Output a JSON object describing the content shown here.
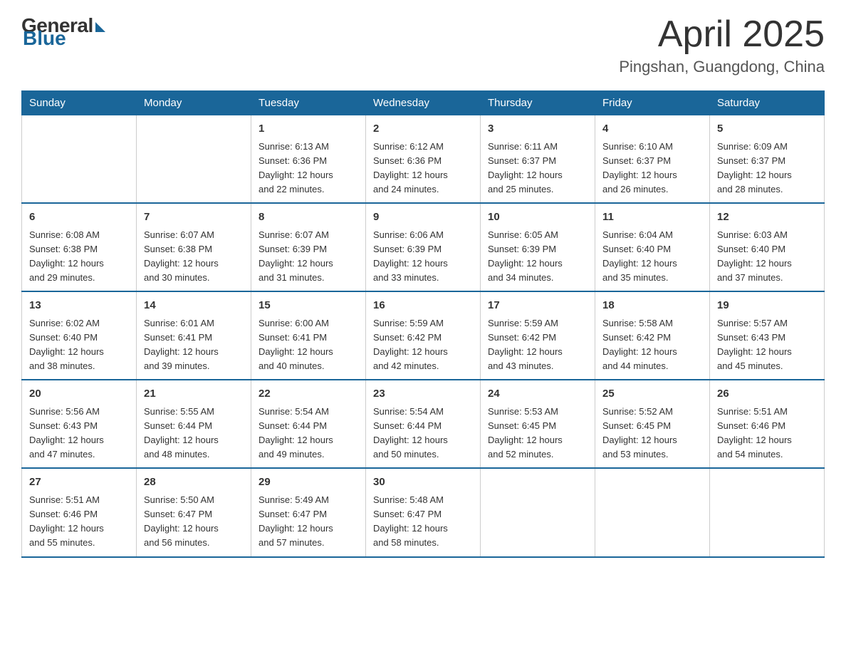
{
  "logo": {
    "general": "General",
    "blue": "Blue"
  },
  "header": {
    "month": "April 2025",
    "location": "Pingshan, Guangdong, China"
  },
  "weekdays": [
    "Sunday",
    "Monday",
    "Tuesday",
    "Wednesday",
    "Thursday",
    "Friday",
    "Saturday"
  ],
  "weeks": [
    [
      {
        "day": "",
        "info": ""
      },
      {
        "day": "",
        "info": ""
      },
      {
        "day": "1",
        "info": "Sunrise: 6:13 AM\nSunset: 6:36 PM\nDaylight: 12 hours\nand 22 minutes."
      },
      {
        "day": "2",
        "info": "Sunrise: 6:12 AM\nSunset: 6:36 PM\nDaylight: 12 hours\nand 24 minutes."
      },
      {
        "day": "3",
        "info": "Sunrise: 6:11 AM\nSunset: 6:37 PM\nDaylight: 12 hours\nand 25 minutes."
      },
      {
        "day": "4",
        "info": "Sunrise: 6:10 AM\nSunset: 6:37 PM\nDaylight: 12 hours\nand 26 minutes."
      },
      {
        "day": "5",
        "info": "Sunrise: 6:09 AM\nSunset: 6:37 PM\nDaylight: 12 hours\nand 28 minutes."
      }
    ],
    [
      {
        "day": "6",
        "info": "Sunrise: 6:08 AM\nSunset: 6:38 PM\nDaylight: 12 hours\nand 29 minutes."
      },
      {
        "day": "7",
        "info": "Sunrise: 6:07 AM\nSunset: 6:38 PM\nDaylight: 12 hours\nand 30 minutes."
      },
      {
        "day": "8",
        "info": "Sunrise: 6:07 AM\nSunset: 6:39 PM\nDaylight: 12 hours\nand 31 minutes."
      },
      {
        "day": "9",
        "info": "Sunrise: 6:06 AM\nSunset: 6:39 PM\nDaylight: 12 hours\nand 33 minutes."
      },
      {
        "day": "10",
        "info": "Sunrise: 6:05 AM\nSunset: 6:39 PM\nDaylight: 12 hours\nand 34 minutes."
      },
      {
        "day": "11",
        "info": "Sunrise: 6:04 AM\nSunset: 6:40 PM\nDaylight: 12 hours\nand 35 minutes."
      },
      {
        "day": "12",
        "info": "Sunrise: 6:03 AM\nSunset: 6:40 PM\nDaylight: 12 hours\nand 37 minutes."
      }
    ],
    [
      {
        "day": "13",
        "info": "Sunrise: 6:02 AM\nSunset: 6:40 PM\nDaylight: 12 hours\nand 38 minutes."
      },
      {
        "day": "14",
        "info": "Sunrise: 6:01 AM\nSunset: 6:41 PM\nDaylight: 12 hours\nand 39 minutes."
      },
      {
        "day": "15",
        "info": "Sunrise: 6:00 AM\nSunset: 6:41 PM\nDaylight: 12 hours\nand 40 minutes."
      },
      {
        "day": "16",
        "info": "Sunrise: 5:59 AM\nSunset: 6:42 PM\nDaylight: 12 hours\nand 42 minutes."
      },
      {
        "day": "17",
        "info": "Sunrise: 5:59 AM\nSunset: 6:42 PM\nDaylight: 12 hours\nand 43 minutes."
      },
      {
        "day": "18",
        "info": "Sunrise: 5:58 AM\nSunset: 6:42 PM\nDaylight: 12 hours\nand 44 minutes."
      },
      {
        "day": "19",
        "info": "Sunrise: 5:57 AM\nSunset: 6:43 PM\nDaylight: 12 hours\nand 45 minutes."
      }
    ],
    [
      {
        "day": "20",
        "info": "Sunrise: 5:56 AM\nSunset: 6:43 PM\nDaylight: 12 hours\nand 47 minutes."
      },
      {
        "day": "21",
        "info": "Sunrise: 5:55 AM\nSunset: 6:44 PM\nDaylight: 12 hours\nand 48 minutes."
      },
      {
        "day": "22",
        "info": "Sunrise: 5:54 AM\nSunset: 6:44 PM\nDaylight: 12 hours\nand 49 minutes."
      },
      {
        "day": "23",
        "info": "Sunrise: 5:54 AM\nSunset: 6:44 PM\nDaylight: 12 hours\nand 50 minutes."
      },
      {
        "day": "24",
        "info": "Sunrise: 5:53 AM\nSunset: 6:45 PM\nDaylight: 12 hours\nand 52 minutes."
      },
      {
        "day": "25",
        "info": "Sunrise: 5:52 AM\nSunset: 6:45 PM\nDaylight: 12 hours\nand 53 minutes."
      },
      {
        "day": "26",
        "info": "Sunrise: 5:51 AM\nSunset: 6:46 PM\nDaylight: 12 hours\nand 54 minutes."
      }
    ],
    [
      {
        "day": "27",
        "info": "Sunrise: 5:51 AM\nSunset: 6:46 PM\nDaylight: 12 hours\nand 55 minutes."
      },
      {
        "day": "28",
        "info": "Sunrise: 5:50 AM\nSunset: 6:47 PM\nDaylight: 12 hours\nand 56 minutes."
      },
      {
        "day": "29",
        "info": "Sunrise: 5:49 AM\nSunset: 6:47 PM\nDaylight: 12 hours\nand 57 minutes."
      },
      {
        "day": "30",
        "info": "Sunrise: 5:48 AM\nSunset: 6:47 PM\nDaylight: 12 hours\nand 58 minutes."
      },
      {
        "day": "",
        "info": ""
      },
      {
        "day": "",
        "info": ""
      },
      {
        "day": "",
        "info": ""
      }
    ]
  ]
}
